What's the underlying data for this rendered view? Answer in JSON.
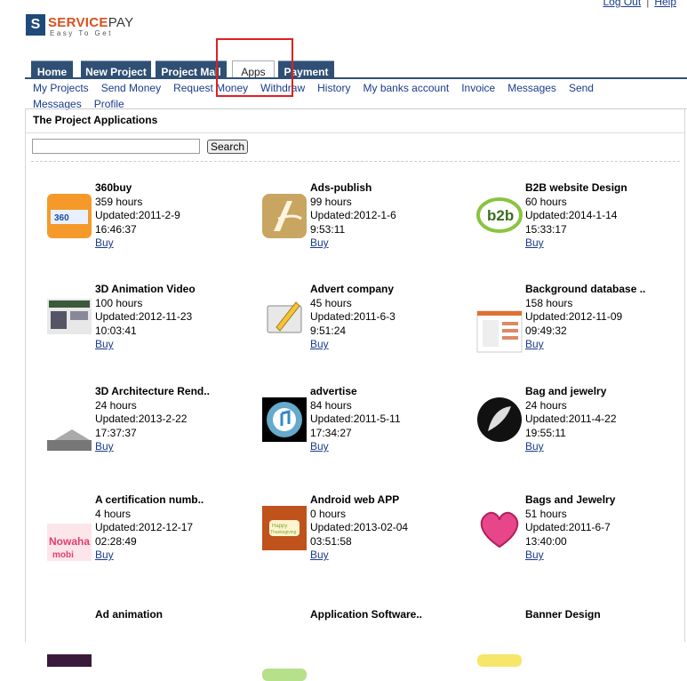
{
  "top_links": {
    "logout": "Log Out",
    "separator": "|",
    "help": "Help"
  },
  "brand": {
    "letter": "S",
    "name_part1": "SERVICE",
    "name_part2": "PAY",
    "tagline": "Easy To Get"
  },
  "tabs": [
    {
      "label": "Home"
    },
    {
      "label": "New Project"
    },
    {
      "label": "Project Mall"
    },
    {
      "label": "Apps"
    },
    {
      "label": "Payment"
    }
  ],
  "subnav": [
    "My Projects",
    "Send Money",
    "Request Money",
    "Withdraw",
    "History",
    "My banks account",
    "Invoice",
    "Messages",
    "Send Messages",
    "Profile"
  ],
  "panel": {
    "title": "The Project Applications",
    "search_value": "",
    "search_button": "Search"
  },
  "apps": [
    {
      "name": "360buy",
      "hours": "359 hours",
      "updated": "Updated:2011-2-9",
      "time": "16:46:37",
      "buy": "Buy",
      "icon": "360buy-icon"
    },
    {
      "name": "Ads-publish",
      "hours": "99 hours",
      "updated": "Updated:2012-1-6",
      "time": "9:53:11",
      "buy": "Buy",
      "icon": "ads-publish-icon"
    },
    {
      "name": "B2B website Design",
      "hours": "60 hours",
      "updated": "Updated:2014-1-14",
      "time": "15:33:17",
      "buy": "Buy",
      "icon": "b2b-icon"
    },
    {
      "name": "3D Animation Video",
      "hours": "100 hours",
      "updated": "Updated:2012-11-23",
      "time": "10:03:41",
      "buy": "Buy",
      "icon": "3d-animation-icon"
    },
    {
      "name": "Advert company",
      "hours": "45 hours",
      "updated": "Updated:2011-6-3",
      "time": "9:51:24",
      "buy": "Buy",
      "icon": "advert-icon"
    },
    {
      "name": "Background database ..",
      "hours": "158 hours",
      "updated": "Updated:2012-11-09",
      "time": "09:49:32",
      "buy": "Buy",
      "icon": "database-icon"
    },
    {
      "name": "3D Architecture Rend..",
      "hours": "24 hours",
      "updated": "Updated:2013-2-22",
      "time": "17:37:37",
      "buy": "Buy",
      "icon": "architecture-icon"
    },
    {
      "name": "advertise",
      "hours": "84 hours",
      "updated": "Updated:2011-5-11",
      "time": "17:34:27",
      "buy": "Buy",
      "icon": "itunes-icon"
    },
    {
      "name": "Bag and jewelry",
      "hours": "24 hours",
      "updated": "Updated:2011-4-22",
      "time": "19:55:11",
      "buy": "Buy",
      "icon": "feather-icon"
    },
    {
      "name": "A certification numb..",
      "hours": "4 hours",
      "updated": "Updated:2012-12-17",
      "time": "02:28:49",
      "buy": "Buy",
      "icon": "certification-icon"
    },
    {
      "name": "Android web APP",
      "hours": "0 hours",
      "updated": "Updated:2013-02-04",
      "time": "03:51:58",
      "buy": "Buy",
      "icon": "thanksgiving-icon"
    },
    {
      "name": "Bags and Jewelry",
      "hours": "51 hours",
      "updated": "Updated:2011-6-7",
      "time": "13:40:00",
      "buy": "Buy",
      "icon": "heart-icon"
    },
    {
      "name": "Ad animation",
      "hours": "",
      "updated": "",
      "time": "",
      "buy": "",
      "icon": "ad-animation-icon"
    },
    {
      "name": "Application Software..",
      "hours": "",
      "updated": "",
      "time": "",
      "buy": "",
      "icon": "app-software-icon"
    },
    {
      "name": "Banner Design",
      "hours": "",
      "updated": "",
      "time": "",
      "buy": "",
      "icon": "banner-icon"
    }
  ]
}
